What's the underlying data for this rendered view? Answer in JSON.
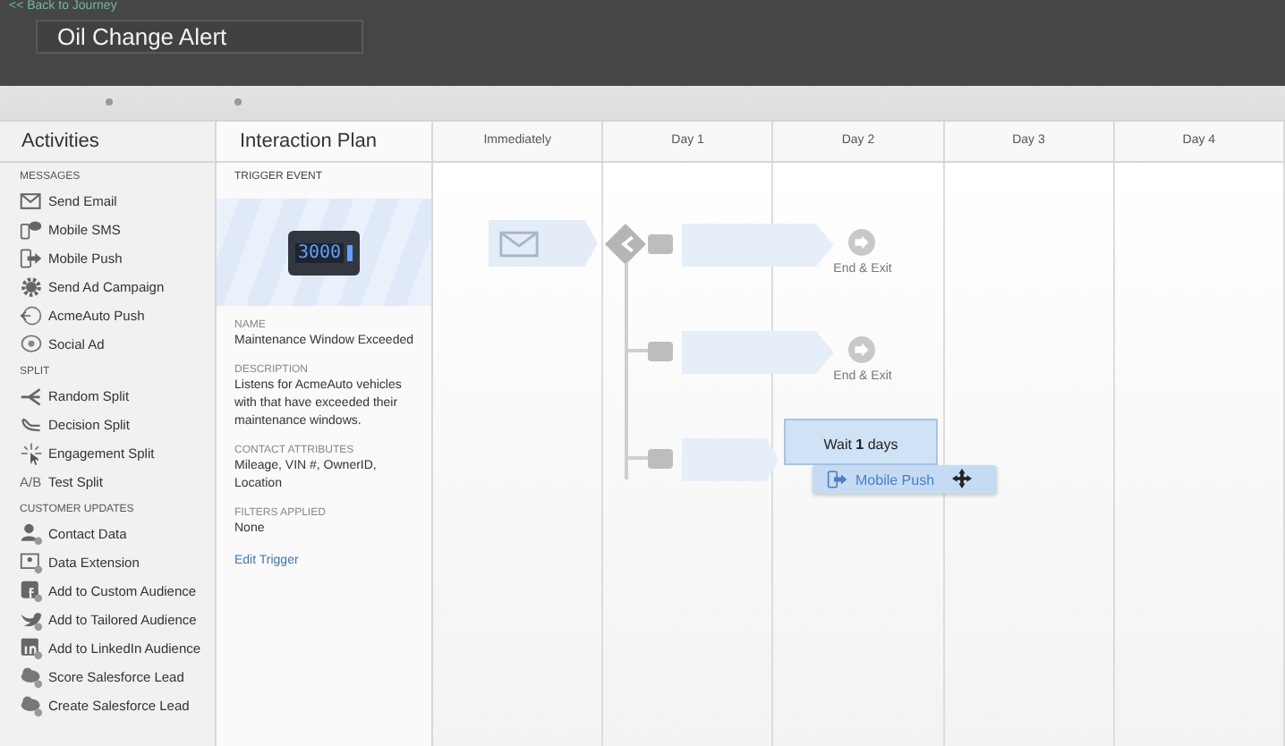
{
  "header": {
    "back_link": "<< Back to Journey",
    "title": "Oil Change Alert"
  },
  "activities": {
    "title": "Activities",
    "sections": [
      {
        "heading": "MESSAGES",
        "items": [
          {
            "kind": "email",
            "label": "Send Email"
          },
          {
            "kind": "sms",
            "label": "Mobile SMS"
          },
          {
            "kind": "push",
            "label": "Mobile Push"
          },
          {
            "kind": "gear",
            "label": "Send Ad Campaign"
          },
          {
            "kind": "acme",
            "label": "AcmeAuto Push"
          },
          {
            "kind": "ad",
            "label": "Social Ad"
          }
        ]
      },
      {
        "heading": "SPLIT",
        "items": [
          {
            "kind": "random",
            "label": "Random Split"
          },
          {
            "kind": "decision",
            "label": "Decision Split"
          },
          {
            "kind": "engagement",
            "label": "Engagement Split"
          },
          {
            "kind": "ab",
            "icon_text": "A/B",
            "label": "Test Split"
          }
        ]
      },
      {
        "heading": "CUSTOMER UPDATES",
        "items": [
          {
            "kind": "person",
            "label": "Contact Data"
          },
          {
            "kind": "data",
            "label": "Data Extension"
          },
          {
            "kind": "facebook",
            "label": "Add to Custom Audience"
          },
          {
            "kind": "twitter",
            "label": "Add to Tailored Audience"
          },
          {
            "kind": "linkedin",
            "label": "Add to LinkedIn Audience"
          },
          {
            "kind": "cloud",
            "label": "Score Salesforce Lead"
          },
          {
            "kind": "cloud",
            "label": "Create Salesforce Lead"
          }
        ]
      }
    ]
  },
  "plan": {
    "title": "Interaction Plan",
    "trigger_heading": "TRIGGER EVENT",
    "display": "3000",
    "fields": [
      {
        "label": "NAME",
        "value": "Maintenance Window Exceeded"
      },
      {
        "label": "DESCRIPTION",
        "value": "Listens for AcmeAuto vehicles with that have exceeded their maintenance windows."
      },
      {
        "label": "CONTACT ATTRIBUTES",
        "value": "Mileage, VIN #, OwnerID, Location"
      },
      {
        "label": "FILTERS APPLIED",
        "value": "None"
      }
    ],
    "edit_link": "Edit Trigger"
  },
  "timeline": {
    "columns": [
      "Immediately",
      "Day 1",
      "Day 2",
      "Day 3",
      "Day 4"
    ],
    "branches": [
      {
        "kind": "end",
        "label": "End & Exit"
      },
      {
        "kind": "end",
        "label": "End & Exit"
      },
      {
        "kind": "wait",
        "label": "Wait **1** days"
      }
    ],
    "dragged": {
      "label": "Mobile Push"
    }
  }
}
